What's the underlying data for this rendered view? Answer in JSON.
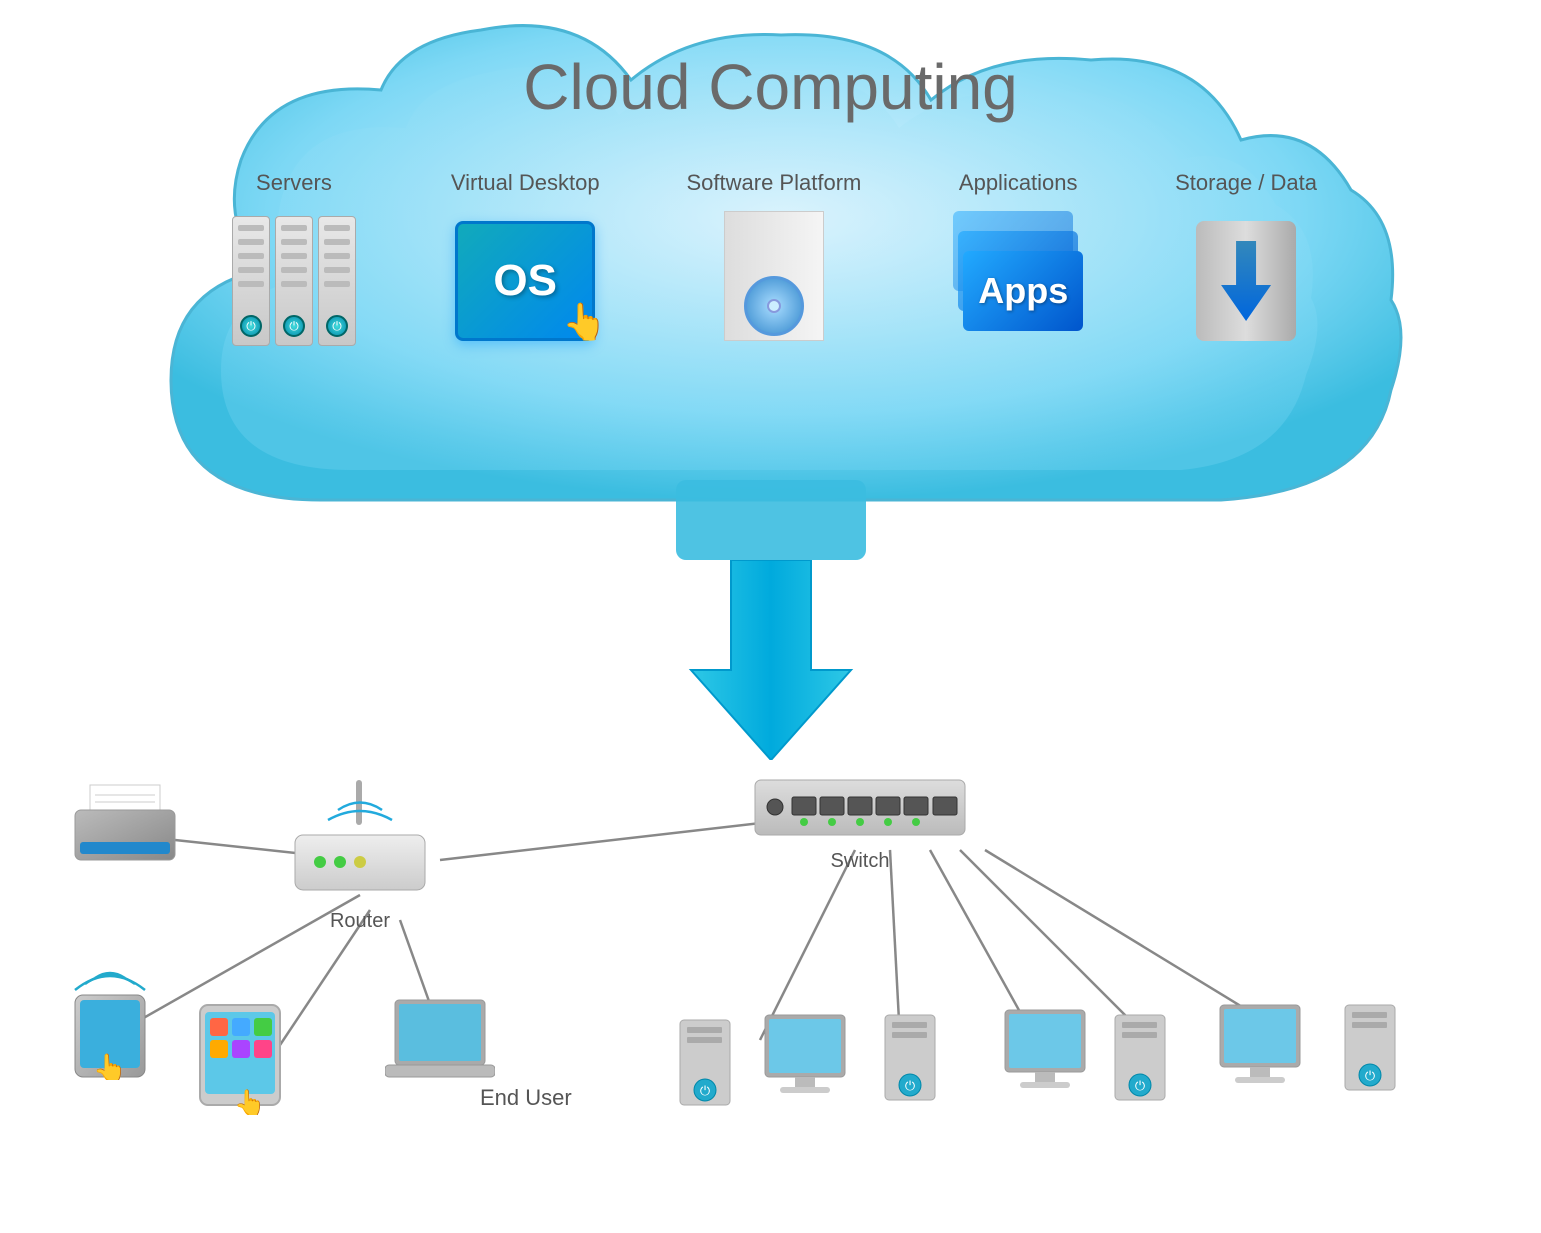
{
  "title": "Cloud Computing",
  "cloud": {
    "items": [
      {
        "id": "servers",
        "label": "Servers"
      },
      {
        "id": "virtual-desktop",
        "label": "Virtual Desktop"
      },
      {
        "id": "software-platform",
        "label": "Software Platform"
      },
      {
        "id": "applications",
        "label": "Applications"
      },
      {
        "id": "storage-data",
        "label": "Storage / Data"
      }
    ]
  },
  "network": {
    "router_label": "Router",
    "switch_label": "Switch",
    "end_user_label": "End User"
  },
  "colors": {
    "cloud_blue": "#5ccfee",
    "arrow_blue": "#1ab4d8",
    "accent": "#0088cc"
  }
}
